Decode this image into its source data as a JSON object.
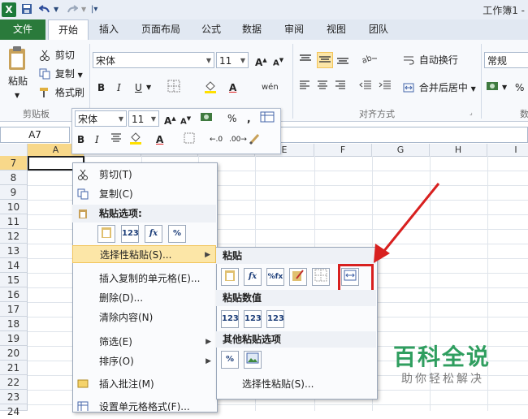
{
  "titlebar": {
    "app_icon": "X",
    "doc_title": "工作簿1 -"
  },
  "tabs": {
    "file": "文件",
    "home": "开始",
    "insert": "插入",
    "page_layout": "页面布局",
    "formulas": "公式",
    "data": "数据",
    "review": "审阅",
    "view": "视图",
    "team": "团队"
  },
  "ribbon": {
    "paste": "粘贴",
    "cut": "剪切",
    "copy": "复制",
    "format_painter": "格式刷",
    "clipboard_group": "剪贴板",
    "font_name": "宋体",
    "font_size": "11",
    "bold": "B",
    "italic": "I",
    "underline": "U",
    "wrap_text": "自动换行",
    "merge_center": "合并后居中",
    "alignment_group": "对齐方式",
    "number_format": "常规",
    "percent": "%",
    "number_group_cut": "数"
  },
  "mini_toolbar": {
    "font_name": "宋体",
    "font_size": "11",
    "percent": "%",
    "comma": ",",
    "bold": "B",
    "italic": "I"
  },
  "namebox": {
    "value": "A7"
  },
  "columns": [
    "A",
    "B",
    "C",
    "D",
    "E",
    "F",
    "G",
    "H",
    "I"
  ],
  "rows": [
    "7",
    "8",
    "9",
    "10",
    "11",
    "12",
    "13",
    "14",
    "15",
    "16",
    "17",
    "18",
    "19",
    "20",
    "21",
    "22",
    "23",
    "24"
  ],
  "context_menu": {
    "cut": "剪切(T)",
    "copy": "复制(C)",
    "paste_options": "粘贴选项:",
    "paste_btns": [
      "123",
      "fx",
      "%"
    ],
    "paste_special": "选择性粘贴(S)...",
    "insert_copied": "插入复制的单元格(E)...",
    "delete": "删除(D)...",
    "clear": "清除内容(N)",
    "filter": "筛选(E)",
    "sort": "排序(O)",
    "insert_comment": "插入批注(M)",
    "format_cells": "设置单元格格式(F)..."
  },
  "submenu": {
    "paste_head": "粘贴",
    "values_head": "粘贴数值",
    "other_head": "其他粘贴选项",
    "paste_special": "选择性粘贴(S)...",
    "value_btns": [
      "123",
      "123",
      "123"
    ],
    "other_btns": [
      "%"
    ]
  },
  "colors": {
    "accent_green": "#2a7a3b",
    "highlight": "#fce6a7",
    "red_annotation": "#d8201f",
    "watermark": "#2f9e5f"
  },
  "watermark": {
    "title": "百科全说",
    "subtitle": "助你轻松解决"
  }
}
